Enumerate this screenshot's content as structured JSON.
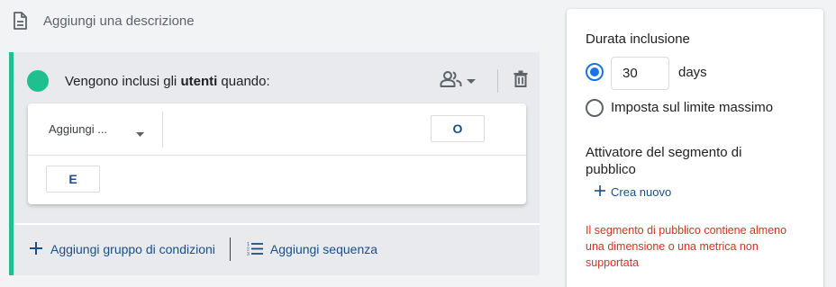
{
  "description": {
    "icon": "document-icon",
    "text": "Aggiungi una descrizione"
  },
  "segment": {
    "header_prefix": "Vengono inclusi gli ",
    "header_bold": "utenti",
    "header_suffix": " quando:",
    "scope_icon": "people-icon",
    "delete_icon": "trash-icon",
    "accent_color": "#1fbf8f",
    "condition": {
      "dimension_placeholder": "Aggiungi ...",
      "or_label": "O",
      "and_label": "E"
    },
    "footer": {
      "add_group_label": "Aggiungi gruppo di condizioni",
      "add_sequence_label": "Aggiungi sequenza"
    }
  },
  "right_panel": {
    "duration_title": "Durata inclusione",
    "duration_value": "30",
    "duration_unit": "days",
    "max_limit_label": "Imposta sul limite massimo",
    "trigger_title": "Attivatore del segmento di pubblico",
    "create_new_label": "Crea nuovo",
    "warning_text": "Il segmento di pubblico contiene almeno una dimensione o una metrica non supportata"
  },
  "colors": {
    "link": "#1a4e8a",
    "radio_active": "#1a73e8",
    "warning": "#d93025"
  }
}
